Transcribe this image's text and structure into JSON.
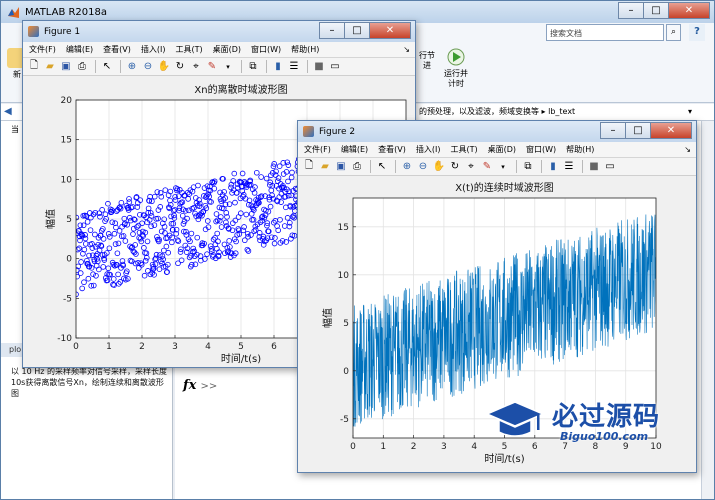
{
  "app": {
    "title": "MATLAB R2018a",
    "search_placeholder": "搜索文档",
    "help_label": "?"
  },
  "ribbon": {
    "tool_run_section": "行节",
    "tool_run_advance_line1": "运行并",
    "tool_run_advance_line2": "计时",
    "tool_new": "新",
    "tool_partial": "进"
  },
  "pathbar": {
    "text": "的预处理，以及滤波，频域变换等 ▸ lb_text"
  },
  "left_pane": {
    "label": "当",
    "tab": "plo",
    "desc": "以 10 Hz 的采样频率对信号采样，采样长度10s获得离散信号Xn，绘制连续和离散波形图"
  },
  "command": {
    "prompt_symbol": "fx",
    "prompt": ">>"
  },
  "figure1": {
    "title": "Figure 1",
    "menus": [
      "文件(F)",
      "编辑(E)",
      "查看(V)",
      "插入(I)",
      "工具(T)",
      "桌面(D)",
      "窗口(W)",
      "帮助(H)"
    ],
    "chart_title": "Xn的离散时域波形图",
    "xlabel": "时间/t(s)",
    "ylabel": "幅值"
  },
  "figure2": {
    "title": "Figure 2",
    "menus": [
      "文件(F)",
      "编辑(E)",
      "查看(V)",
      "插入(I)",
      "工具(T)",
      "桌面(D)",
      "窗口(W)",
      "帮助(H)"
    ],
    "chart_title": "X(t)的连续时域波形图",
    "xlabel": "时间/t(s)",
    "ylabel": "幅值"
  },
  "watermark": {
    "text": "必过源码",
    "url": "Biguo100.com"
  },
  "colors": {
    "scatter_marker": "#0000ff",
    "line_series": "#0072bd"
  },
  "chart_data": [
    {
      "type": "scatter",
      "title": "Xn的离散时域波形图",
      "xlabel": "时间/t(s)",
      "ylabel": "幅值",
      "xlim": [
        0,
        10
      ],
      "ylim": [
        -10,
        20
      ],
      "xticks": [
        0,
        1,
        2,
        3,
        4,
        5,
        6,
        7,
        8,
        9,
        10
      ],
      "yticks": [
        -10,
        -5,
        0,
        5,
        10,
        15,
        20
      ],
      "grid": true,
      "marker": "circle",
      "trend": {
        "x": [
          0,
          10
        ],
        "y": [
          0,
          10
        ]
      },
      "spread": [
        -4.5,
        6
      ]
    },
    {
      "type": "line",
      "title": "X(t)的连续时域波形图",
      "xlabel": "时间/t(s)",
      "ylabel": "幅值",
      "xlim": [
        0,
        10
      ],
      "ylim": [
        -7,
        18
      ],
      "xticks": [
        0,
        1,
        2,
        3,
        4,
        5,
        6,
        7,
        8,
        9,
        10
      ],
      "yticks": [
        -5,
        0,
        5,
        10,
        15
      ],
      "grid": true,
      "trend": {
        "x": [
          0,
          10
        ],
        "y": [
          0,
          10
        ]
      },
      "spread": [
        -6,
        7
      ]
    }
  ]
}
